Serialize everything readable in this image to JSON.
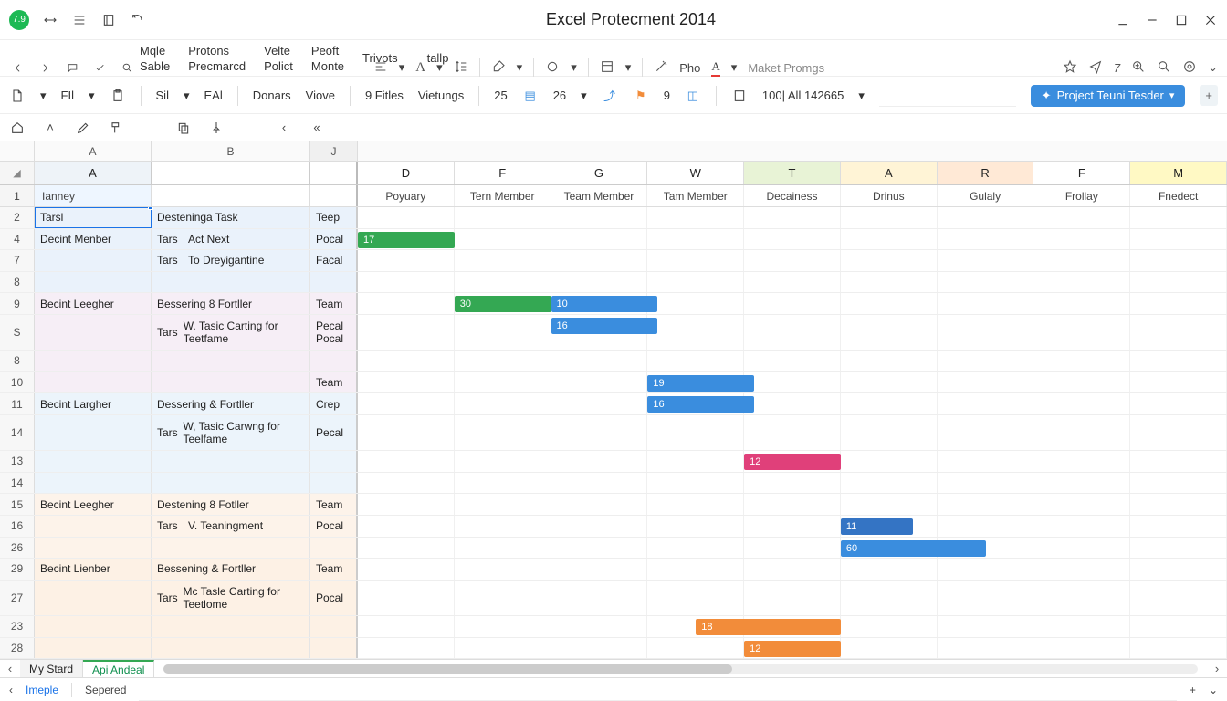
{
  "app_title": "Excel Protecment 2014",
  "avatar": "7.9",
  "menu": {
    "top": [
      "Mqle",
      "Protons",
      "Velte",
      "Peoft",
      "tallp"
    ],
    "bottom": [
      "Sable",
      "Precmarcd",
      "Polict",
      "Monte",
      "Trivots"
    ]
  },
  "toolbar": {
    "pho": "Pho",
    "maket": "Maket Promgs"
  },
  "ribbon": {
    "fil": "FIl",
    "sil": "Sil",
    "eal": "EAl",
    "donars": "Donars",
    "viove": "Viove",
    "filters": "9 Fitles",
    "vietungs": "Vietungs",
    "num1": "25",
    "num2": "26",
    "num3": "9",
    "range": "100| All 142665",
    "primary": "Project Teuni Tesder"
  },
  "letters": {
    "a": "A",
    "b": "B",
    "j": "J"
  },
  "frozen_cols": [
    "D",
    "F",
    "G",
    "W",
    "T",
    "A",
    "R",
    "F",
    "M"
  ],
  "frozen_a": "A",
  "row1_gutter": "1",
  "row1_a": "Ianney",
  "sub_labels": [
    "Poyuary",
    "Tern Member",
    "Team Member",
    "Tam Member",
    "Decainess",
    "Drinus",
    "Gulaly",
    "Frollay",
    "Fnedect"
  ],
  "rows": [
    {
      "g": "2",
      "a": "Tarsl",
      "b": "Desteninga Task",
      "c": "Teep",
      "bg": "bg-blue-lt",
      "sel": true
    },
    {
      "g": "4",
      "a": "Decint Menber",
      "pref": "Tars",
      "b": "Act Next",
      "c": "Pocal",
      "bg": "bg-blue-lt",
      "bar": {
        "col": 0,
        "span": 1,
        "cls": "b-green",
        "label": "17"
      }
    },
    {
      "g": "7",
      "a": "",
      "pref": "Tars",
      "b": "To Dreyigantine",
      "c": "Facal",
      "bg": "bg-blue-lt"
    },
    {
      "g": "8",
      "a": "",
      "b": "",
      "c": "",
      "bg": "bg-blue-lt"
    },
    {
      "g": "9",
      "a": "Becint Leegher",
      "b": "Bessering 8 Fortller",
      "c": "Team",
      "bg": "bg-pink-lt",
      "bars": [
        {
          "col": 1,
          "span": 1,
          "cls": "b-green",
          "label": "30"
        },
        {
          "col": 2,
          "span": 1.1,
          "cls": "b-blue",
          "label": "10"
        }
      ]
    },
    {
      "g": "S",
      "a": "",
      "pref": "Tars",
      "b": "W. Tasic Carting for Teetfame",
      "c": "Pecal Pocal",
      "bg": "bg-pink-lt",
      "tall": true,
      "bar": {
        "col": 2,
        "span": 1.1,
        "cls": "b-blue",
        "label": "16"
      }
    },
    {
      "g": "8",
      "a": "",
      "b": "",
      "c": "",
      "bg": "bg-pink-lt"
    },
    {
      "g": "10",
      "a": "",
      "b": "",
      "c": "Team",
      "bg": "bg-pink-lt",
      "bar": {
        "col": 3,
        "span": 1.1,
        "cls": "b-blue",
        "label": "19"
      }
    },
    {
      "g": "11",
      "a": "Becint Largher",
      "b": "Dessering & Fortller",
      "c": "Crep",
      "bg": "bg-blue-lt2",
      "bar": {
        "col": 3,
        "span": 1.1,
        "cls": "b-blue",
        "label": "16"
      }
    },
    {
      "g": "14",
      "a": "",
      "pref": "Tars",
      "b": "W, Tasic Carwng for Teelfame",
      "c": "Pecal",
      "bg": "bg-blue-lt2",
      "tall": true
    },
    {
      "g": "13",
      "a": "",
      "b": "",
      "c": "",
      "bg": "bg-blue-lt2",
      "bar": {
        "col": 4,
        "span": 1,
        "cls": "b-pink",
        "label": "12"
      }
    },
    {
      "g": "14",
      "a": "",
      "b": "",
      "c": "",
      "bg": "bg-blue-lt2"
    },
    {
      "g": "15",
      "a": "Becint Leegher",
      "b": "Destening 8 Fotller",
      "c": "Team",
      "bg": "bg-peach-lt"
    },
    {
      "g": "16",
      "a": "",
      "pref": "Tars",
      "b": "V.  Teaningment",
      "c": "Pocal",
      "bg": "bg-peach-lt",
      "bar": {
        "col": 5,
        "span": 0.75,
        "cls": "b-blue-dk",
        "label": "11"
      }
    },
    {
      "g": "26",
      "a": "",
      "b": "",
      "c": "",
      "bg": "bg-peach-lt",
      "bar": {
        "col": 5,
        "span": 1.5,
        "cls": "b-blue",
        "label": "60"
      }
    },
    {
      "g": "29",
      "a": "Becint Lienber",
      "b": "Bessening & Fortller",
      "c": "Team",
      "bg": "bg-peach-lt2"
    },
    {
      "g": "27",
      "a": "",
      "pref": "Tars",
      "b": "Mc Tasle Carting for Teetlome",
      "c": "Pocal",
      "bg": "bg-peach-lt2",
      "tall": true
    },
    {
      "g": "23",
      "a": "",
      "b": "",
      "c": "",
      "bg": "bg-peach-lt2",
      "bar": {
        "col": 3.5,
        "span": 1.5,
        "cls": "b-orange",
        "label": "18"
      }
    },
    {
      "g": "28",
      "a": "",
      "b": "",
      "c": "",
      "bg": "bg-peach-lt2",
      "bar": {
        "col": 4,
        "span": 1,
        "cls": "b-orange",
        "label": "12"
      }
    }
  ],
  "sheets": {
    "tab1": "My Stard",
    "tab2": "Api  Andeal"
  },
  "status": {
    "left1": "Imeple",
    "left2": "Sepered"
  }
}
